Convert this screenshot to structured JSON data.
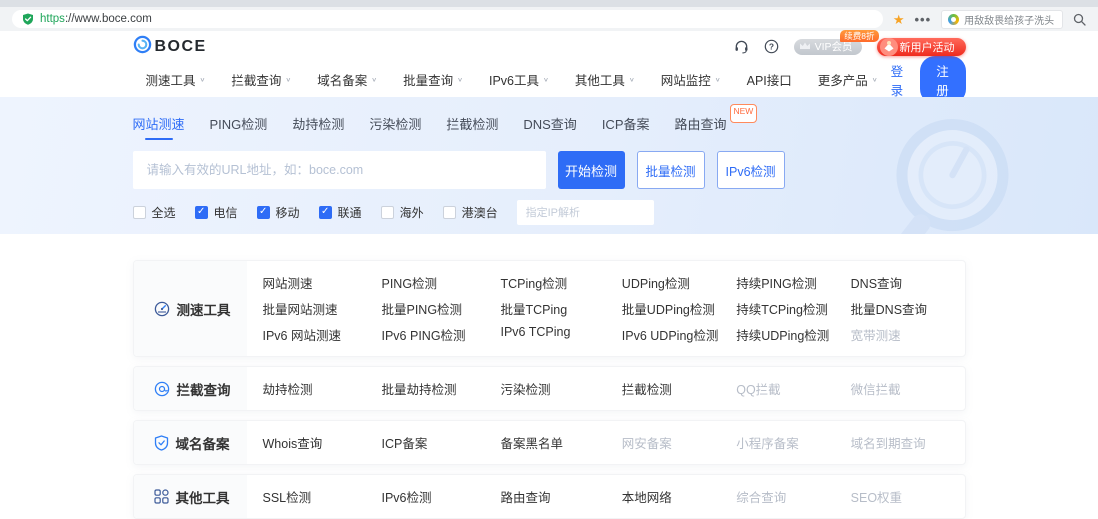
{
  "browser": {
    "url_scheme": "https",
    "url_rest": "://www.boce.com",
    "search_text": "用敌敌畏给孩子洗头"
  },
  "header": {
    "logo_text": "BOCE",
    "vip_label": "VIP会员",
    "vip_ribbon": "续费8折",
    "promo_label": "新用户活动",
    "login_label": "登录",
    "register_label": "注册"
  },
  "nav": {
    "items": [
      {
        "label": "测速工具",
        "arrow": true
      },
      {
        "label": "拦截查询",
        "arrow": true
      },
      {
        "label": "域名备案",
        "arrow": true
      },
      {
        "label": "批量查询",
        "arrow": true
      },
      {
        "label": "IPv6工具",
        "arrow": true
      },
      {
        "label": "其他工具",
        "arrow": true
      },
      {
        "label": "网站监控",
        "arrow": true
      },
      {
        "label": "API接口"
      },
      {
        "label": "更多产品",
        "arrow": true
      }
    ]
  },
  "hero": {
    "tabs": [
      {
        "label": "网站测速",
        "active": true
      },
      {
        "label": "PING检测"
      },
      {
        "label": "劫持检测"
      },
      {
        "label": "污染检测"
      },
      {
        "label": "拦截检测"
      },
      {
        "label": "DNS查询"
      },
      {
        "label": "ICP备案"
      },
      {
        "label": "路由查询",
        "badge": "NEW"
      }
    ],
    "url_placeholder": "请输入有效的URL地址，如：boce.com",
    "start_button": "开始检测",
    "batch_button": "批量检测",
    "ipv6_button": "IPv6检测",
    "options": [
      {
        "label": "全选"
      },
      {
        "label": "电信",
        "checked": true
      },
      {
        "label": "移动",
        "checked": true
      },
      {
        "label": "联通",
        "checked": true
      },
      {
        "label": "海外"
      },
      {
        "label": "港澳台"
      }
    ],
    "ip_placeholder": "指定IP解析"
  },
  "tools": {
    "sections": [
      {
        "title": "测速工具",
        "icon": "speedometer-icon",
        "links": [
          {
            "label": "网站测速"
          },
          {
            "label": "PING检测"
          },
          {
            "label": "TCPing检测"
          },
          {
            "label": "UDPing检测"
          },
          {
            "label": "持续PING检测"
          },
          {
            "label": "DNS查询"
          },
          {
            "label": "批量网站测速"
          },
          {
            "label": "批量PING检测"
          },
          {
            "label": "批量TCPing"
          },
          {
            "label": "批量UDPing检测"
          },
          {
            "label": "持续TCPing检测"
          },
          {
            "label": "批量DNS查询"
          },
          {
            "label": "IPv6 网站测速"
          },
          {
            "label": "IPv6 PING检测"
          },
          {
            "label": "IPv6 TCPing"
          },
          {
            "label": "IPv6 UDPing检测"
          },
          {
            "label": "持续UDPing检测"
          },
          {
            "label": "宽带测速",
            "muted": true
          }
        ]
      },
      {
        "title": "拦截查询",
        "icon": "at-circle-icon",
        "links": [
          {
            "label": "劫持检测"
          },
          {
            "label": "批量劫持检测"
          },
          {
            "label": "污染检测"
          },
          {
            "label": "拦截检测"
          },
          {
            "label": "QQ拦截",
            "muted": true
          },
          {
            "label": "微信拦截",
            "muted": true
          }
        ]
      },
      {
        "title": "域名备案",
        "icon": "shield-check-icon",
        "links": [
          {
            "label": "Whois查询"
          },
          {
            "label": "ICP备案"
          },
          {
            "label": "备案黑名单"
          },
          {
            "label": "网安备案",
            "muted": true
          },
          {
            "label": "小程序备案",
            "muted": true
          },
          {
            "label": "域名到期查询",
            "muted": true
          }
        ]
      },
      {
        "title": "其他工具",
        "icon": "grid-icon",
        "links": [
          {
            "label": "SSL检测"
          },
          {
            "label": "IPv6检测"
          },
          {
            "label": "路由查询"
          },
          {
            "label": "本地网络"
          },
          {
            "label": "综合查询",
            "muted": true
          },
          {
            "label": "SEO权重",
            "muted": true
          }
        ]
      }
    ]
  },
  "colors": {
    "accent": "#2e6cf6",
    "register_blue": "#3370ff",
    "secure_green": "#1fa65a",
    "star_orange": "#f7a325",
    "promo_red": "#ef2b1e",
    "ribbon_orange": "#ff7a2b",
    "new_badge_orange": "#ff6a3d",
    "muted_link": "#b7bdc8"
  }
}
